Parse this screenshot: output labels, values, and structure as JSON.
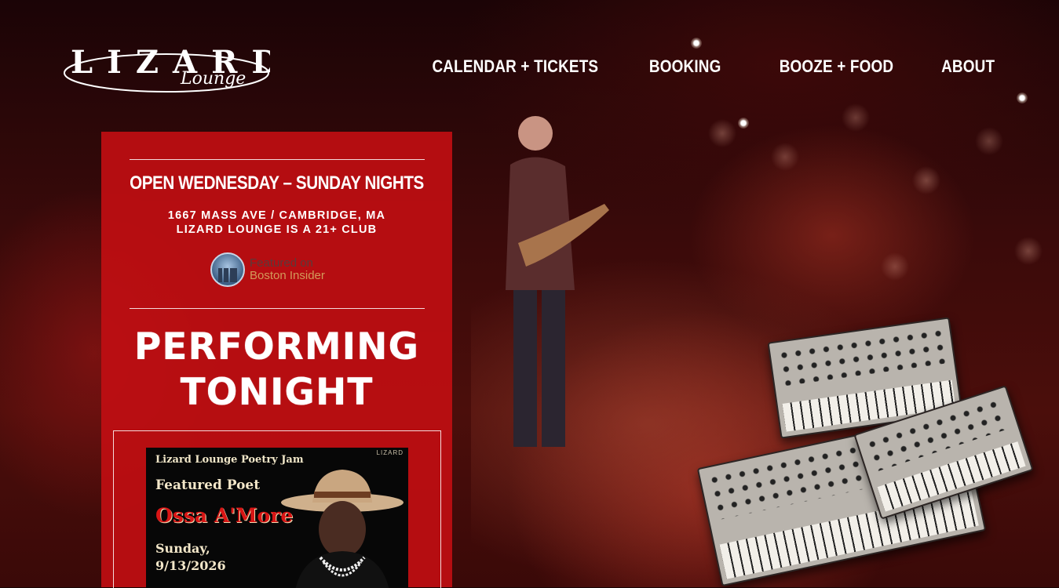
{
  "brand": {
    "name": "LIZARD",
    "script": "Lounge"
  },
  "nav": [
    {
      "label": "CALENDAR + TICKETS"
    },
    {
      "label": "BOOKING"
    },
    {
      "label": "BOOZE + FOOD"
    },
    {
      "label": "ABOUT"
    }
  ],
  "panel": {
    "hours": "OPEN WEDNESDAY – SUNDAY NIGHTS",
    "address_line1": "1667 MASS AVE / CAMBRIDGE, MA",
    "address_line2": "LIZARD LOUNGE IS A 21+ CLUB",
    "badge": {
      "line1": "Featured on",
      "line2": "Boston Insider"
    },
    "performing_line1": "PERFORMING",
    "performing_line2": "TONIGHT"
  },
  "event": {
    "poster_title": "Lizard Lounge Poetry Jam",
    "poster_brand": "LIZARD",
    "feature_label": "Featured Poet",
    "artist": "Ossa A'More",
    "day": "Sunday,",
    "date": "9/13/2026"
  },
  "colors": {
    "panel_red": "#be0e12",
    "artist_red": "#d81515"
  }
}
